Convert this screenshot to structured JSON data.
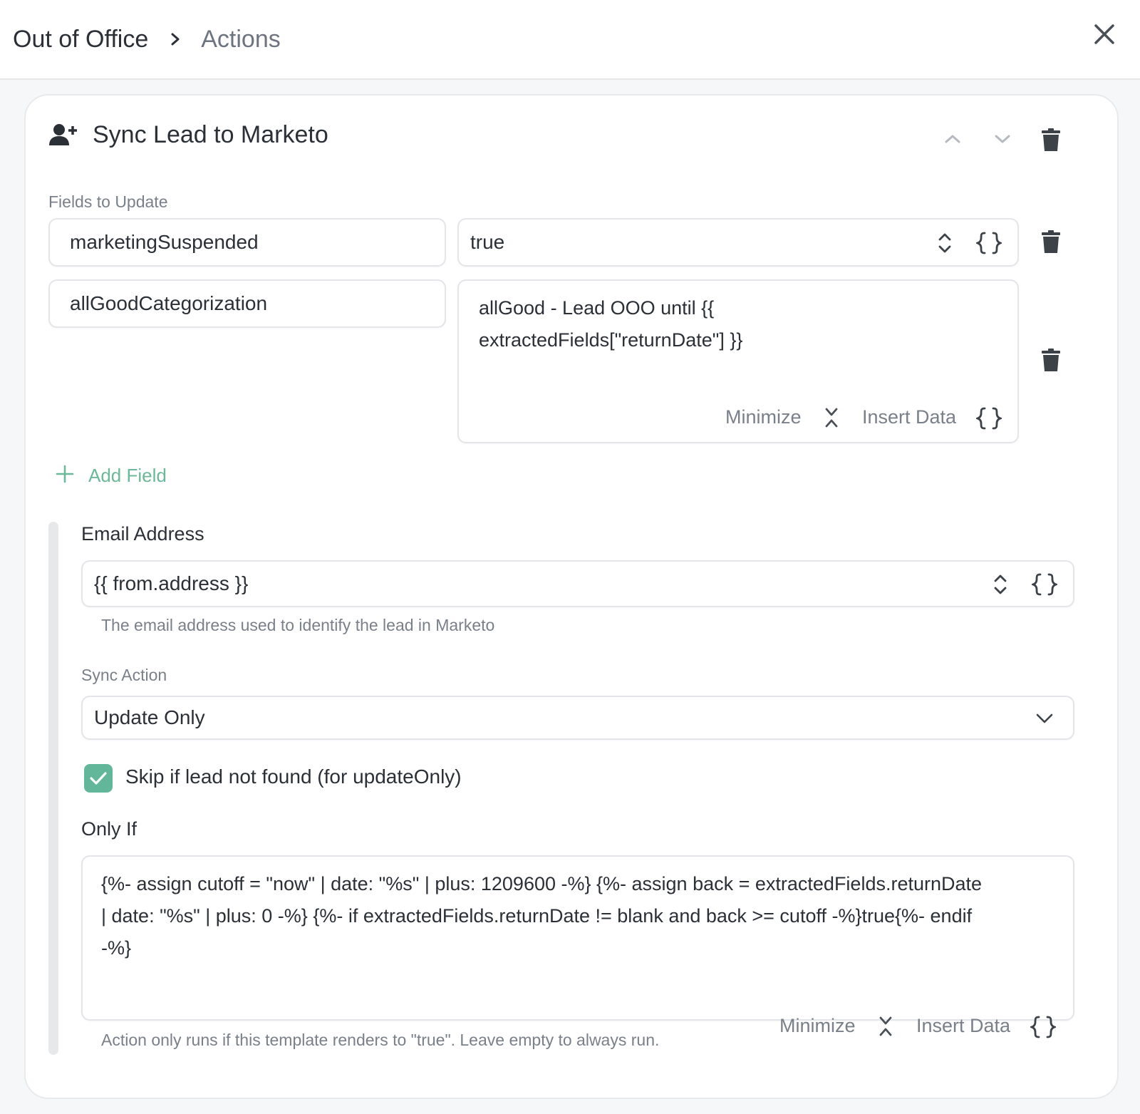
{
  "breadcrumb": {
    "root": "Out of Office",
    "current": "Actions"
  },
  "action": {
    "title": "Sync Lead to Marketo"
  },
  "fields_section": {
    "label": "Fields to Update",
    "rows": [
      {
        "name": "marketingSuspended",
        "value": "true"
      },
      {
        "name": "allGoodCategorization",
        "value_line1": "allGood - Lead OOO until {{",
        "value_line2": "extractedFields[\"returnDate\"] }}"
      }
    ],
    "minimize_label": "Minimize",
    "insert_data_label": "Insert Data",
    "add_field_label": "Add Field"
  },
  "email": {
    "label": "Email Address",
    "value": "{{ from.address }}",
    "helper": "The email address used to identify the lead in Marketo"
  },
  "sync_action": {
    "label": "Sync Action",
    "selected": "Update Only"
  },
  "skip_checkbox": {
    "label": "Skip if lead not found (for updateOnly)",
    "checked": true
  },
  "only_if": {
    "label": "Only If",
    "line1": "{%- assign cutoff = \"now\" | date: \"%s\" | plus: 1209600 -%} {%- assign back = extractedFields.returnDate",
    "line2": "| date: \"%s\" | plus: 0 -%} {%- if extractedFields.returnDate != blank and back >= cutoff -%}true{%- endif",
    "line3": "-%}",
    "helper": "Action only runs if this template renders to \"true\". Leave empty to always run.",
    "minimize_label": "Minimize",
    "insert_data_label": "Insert Data"
  },
  "colors": {
    "accent": "#62b79a",
    "accent_text": "#6cb89a",
    "muted": "#7a808a",
    "text": "#2b2f36"
  }
}
